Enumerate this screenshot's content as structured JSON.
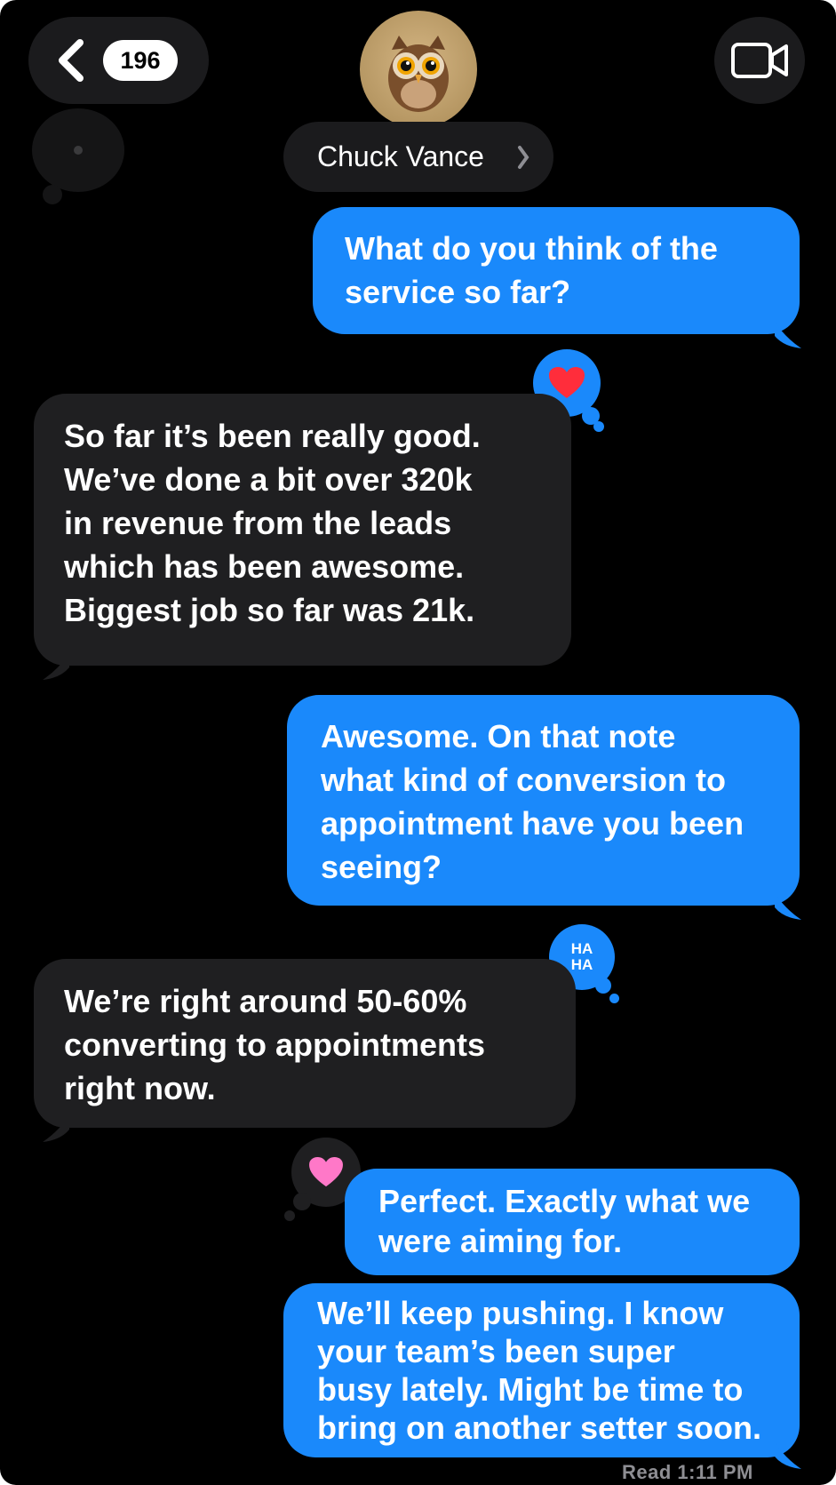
{
  "header": {
    "back_count": "196",
    "contact_name": "Chuck Vance",
    "avatar_icon": "owl-memoji",
    "video_icon": "video-camera-icon"
  },
  "messages": [
    {
      "side": "outgoing",
      "text": "What do you think of the\nservice so far?"
    },
    {
      "side": "incoming",
      "text": "So far it’s been really good.\nWe’ve done a bit over 320k\nin revenue from the leads\nwhich has been awesome.\nBiggest job so far was 21k.",
      "reaction": "heart"
    },
    {
      "side": "outgoing",
      "text": "Awesome. On that note\nwhat kind of conversion to\nappointment have you been\nseeing?"
    },
    {
      "side": "incoming",
      "text": "We’re right around 50-60%\nconverting to appointments\nright now.",
      "reaction": "haha"
    },
    {
      "side": "outgoing",
      "text": "Perfect. Exactly what we\nwere aiming for.",
      "reaction": "pink-heart"
    },
    {
      "side": "outgoing",
      "text": "We’ll keep pushing. I know\nyour team’s been super\nbusy lately. Might be time to\nbring on another setter soon."
    }
  ],
  "reactions": {
    "haha_text": "HA\nHA"
  },
  "status": {
    "read_receipt": "Read  1:11 PM"
  },
  "colors": {
    "outgoing": "#1a89fb",
    "incoming": "#1f1f21",
    "background": "#000000"
  }
}
